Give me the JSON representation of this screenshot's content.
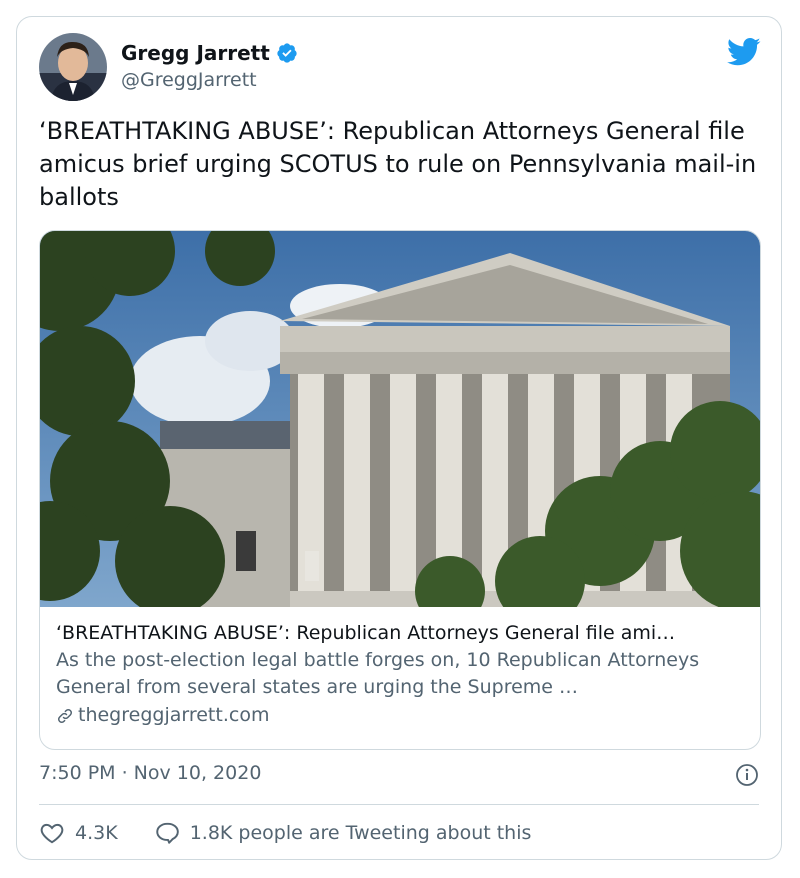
{
  "author": {
    "name": "Gregg Jarrett",
    "handle": "@GreggJarrett",
    "verified": true
  },
  "tweet": {
    "text": "‘BREATHTAKING ABUSE’: Republican Attorneys General file amicus brief urging SCOTUS to rule on Pennsylvania mail-in ballots"
  },
  "link_card": {
    "title": "‘BREATHTAKING ABUSE’: Republican Attorneys General file ami…",
    "description": "As the post-election legal battle forges on, 10 Republican Attorneys General from several states are urging the Supreme …",
    "domain": "thegreggjarrett.com"
  },
  "meta": {
    "timestamp": "7:50 PM · Nov 10, 2020"
  },
  "actions": {
    "likes": "4.3K",
    "tweeting": "1.8K people are Tweeting about this"
  },
  "colors": {
    "brand_blue": "#1d9bf0",
    "text_primary": "#0f1419",
    "text_secondary": "#536471",
    "border": "#cfd9de"
  }
}
